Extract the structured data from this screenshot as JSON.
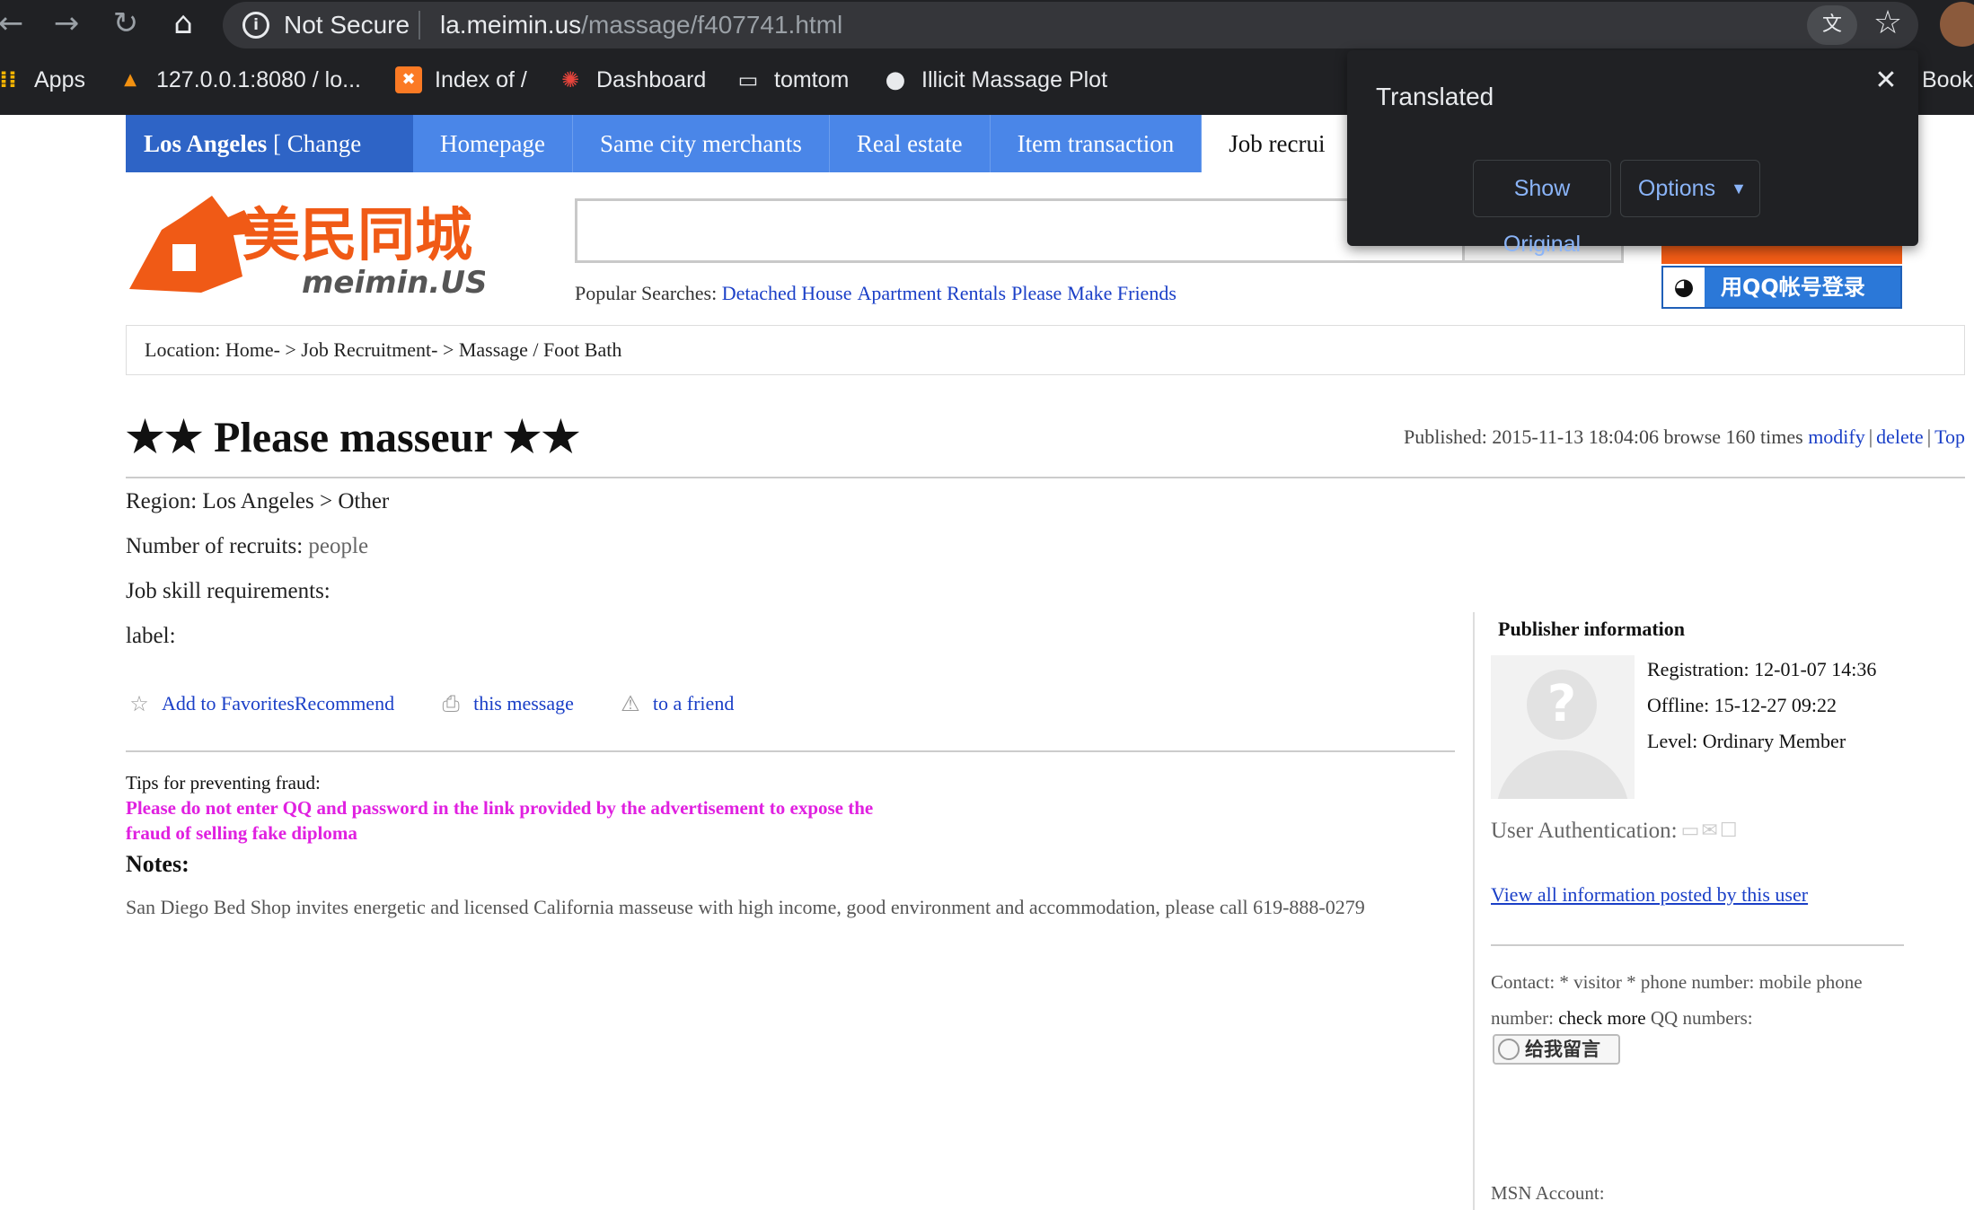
{
  "browser": {
    "security": "Not Secure",
    "url_host": "la.meimin.us",
    "url_path": "/massage/f407741.html",
    "bookmarks": [
      {
        "label": "Apps",
        "icon": "apps-grid-icon"
      },
      {
        "label": "127.0.0.1:8080 / lo...",
        "icon": "phpmyadmin-icon"
      },
      {
        "label": "Index of /",
        "icon": "xampp-icon"
      },
      {
        "label": "Dashboard",
        "icon": "dashboard-icon"
      },
      {
        "label": "tomtom",
        "icon": "folder-icon"
      },
      {
        "label": "Illicit Massage Plot",
        "icon": "globe-icon"
      }
    ],
    "bookmarks_overflow": "Book"
  },
  "translate_popup": {
    "title": "Translated",
    "show_original": "Show Original",
    "options": "Options"
  },
  "nav": {
    "city": "Los Angeles",
    "change": "[ Change",
    "items": [
      "Homepage",
      "Same city merchants",
      "Real estate",
      "Item transaction",
      "Job recrui"
    ]
  },
  "logo": {
    "cn": "美民同城",
    "en": "meimin.US"
  },
  "qq_login": "用QQ帐号登录",
  "popular": {
    "label": "Popular Searches:",
    "items": [
      "Detached House",
      "Apartment Rentals",
      "Please",
      "Make Friends"
    ]
  },
  "breadcrumb": {
    "label": "Location:",
    "path": "Home- > Job Recruitment- > Massage / Foot Bath"
  },
  "post": {
    "title": "★★ Please masseur ★★",
    "published": "Published: 2015-11-13 18:04:06 browse 160 times",
    "modify": "modify",
    "delete": "delete",
    "top": "Top",
    "region_label": "Region:",
    "region_value": "Los Angeles > Other",
    "recruits_label": "Number of recruits:",
    "recruits_value": "people",
    "skill_label": "Job skill requirements:",
    "tag_label": "label:",
    "actions": [
      "Add to FavoritesRecommend",
      "this message",
      "to a friend"
    ],
    "tips_label": "Tips for preventing fraud:",
    "tips_warning": "Please do not enter QQ and password in the link provided by the advertisement to expose the fraud of selling fake diploma",
    "notes_heading": "Notes:",
    "notes_body": "San Diego Bed Shop invites energetic and licensed California masseuse with high income, good environment and accommodation, please call 619-888-0279"
  },
  "publisher": {
    "heading": "Publisher information",
    "registration": "Registration: 12-01-07 14:36",
    "offline": "Offline: 15-12-27 09:22",
    "level": "Level: Ordinary Member",
    "auth_label": "User Authentication:",
    "view_all": "View all information posted by this user",
    "contact_a": "Contact: * visitor * phone number: mobile phone number:",
    "contact_b": "check more",
    "contact_c": "QQ numbers:",
    "message_btn": "给我留言",
    "msn": "MSN Account:"
  }
}
